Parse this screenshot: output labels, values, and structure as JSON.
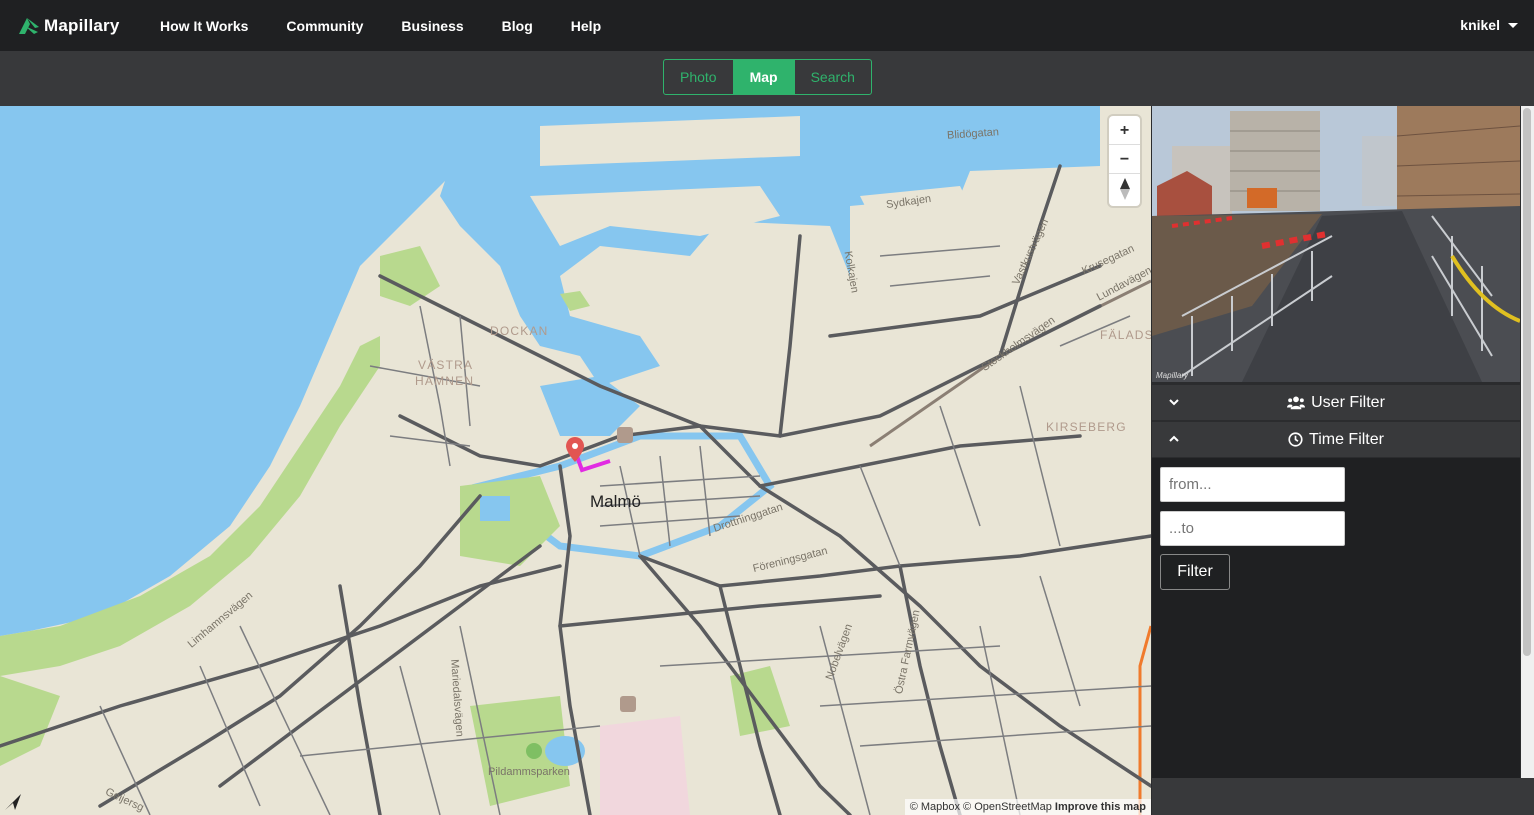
{
  "app": {
    "brand": "Mapillary",
    "accent_color": "#2fb36c"
  },
  "nav": {
    "links": [
      "How It Works",
      "Community",
      "Business",
      "Blog",
      "Help"
    ],
    "user": "knikel"
  },
  "view_toggle": {
    "options": [
      "Photo",
      "Map",
      "Search"
    ],
    "active": "Map"
  },
  "map": {
    "zoom_in": "+",
    "zoom_out": "−",
    "city": "Malmö",
    "districts": [
      "DOCKAN",
      "VÄSTRA",
      "HAMNEN",
      "KIRSEBERG",
      "FÄLADS"
    ],
    "streets": [
      "Blidögatan",
      "Sydkajen",
      "Kolkajen",
      "Vastkustvägen",
      "Krusegatan",
      "Lundavägen",
      "Stockholmsvägen",
      "Drottninggatan",
      "Föreningsgatan",
      "Limhamnsvägen",
      "Mariedalsvägen",
      "Nobelvägen",
      "Östra Farmvägen",
      "Pildammsparken",
      "Geijersg"
    ],
    "attribution": "© Mapbox © OpenStreetMap",
    "improve_link": "Improve this map",
    "marker_icon": "map-pin-icon",
    "route_color": "#e12be2"
  },
  "side_panel": {
    "user_filter_label": "User Filter",
    "time_filter_label": "Time Filter",
    "from_placeholder": "from...",
    "to_placeholder": "...to",
    "filter_button": "Filter",
    "photo_watermark": "Mapillary"
  }
}
